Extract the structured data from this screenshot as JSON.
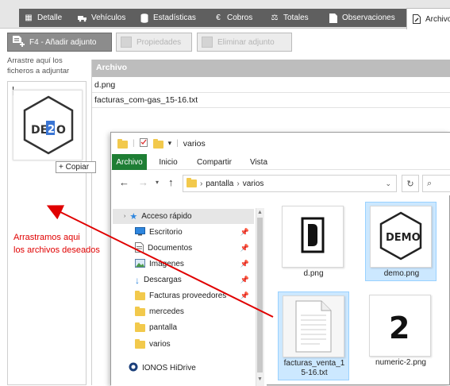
{
  "tabs": [
    {
      "label": "Detalle",
      "icon": "grid-icon"
    },
    {
      "label": "Vehículos",
      "icon": "truck-icon"
    },
    {
      "label": "Estadísticas",
      "icon": "database-icon"
    },
    {
      "label": "Cobros",
      "icon": "euro-icon"
    },
    {
      "label": "Totales",
      "icon": "scale-icon"
    },
    {
      "label": "Observaciones",
      "icon": "note-icon"
    },
    {
      "label": "Archivo",
      "icon": "file-edit-icon"
    }
  ],
  "toolbar": {
    "add_label": "F4 - Añadir adjunto",
    "properties_label": "Propiedades",
    "delete_label": "Eliminar adjunto"
  },
  "drop_hint": "Arrastre aquí los ficheros a adjuntar",
  "drag": {
    "copy_label": "+ Copiar",
    "thumb_text": "DEMO",
    "thumb_digit": "2"
  },
  "grid": {
    "header": "Archivo",
    "rows": [
      "d.png",
      "facturas_com-gas_15-16.txt"
    ]
  },
  "annotation": {
    "line1": "Arrastramos aqui",
    "line2": "los archivos deseados"
  },
  "explorer": {
    "title": "varios",
    "ribbon_tabs": [
      "Archivo",
      "Inicio",
      "Compartir",
      "Vista"
    ],
    "address": {
      "part1": "pantalla",
      "part2": "varios"
    },
    "nav_items": [
      {
        "label": "Acceso rápido",
        "icon": "star-icon",
        "selected": true
      },
      {
        "label": "Escritorio",
        "icon": "desktop-icon",
        "pinned": true
      },
      {
        "label": "Documentos",
        "icon": "documents-icon",
        "pinned": true
      },
      {
        "label": "Imágenes",
        "icon": "images-icon",
        "pinned": true
      },
      {
        "label": "Descargas",
        "icon": "download-icon",
        "pinned": true
      },
      {
        "label": "Facturas proveedores",
        "icon": "folder-icon",
        "pinned": true
      },
      {
        "label": "mercedes",
        "icon": "folder-icon"
      },
      {
        "label": "pantalla",
        "icon": "folder-icon"
      },
      {
        "label": "varios",
        "icon": "folder-icon"
      },
      {
        "label": "IONOS HiDrive",
        "icon": "cloud-drive-icon"
      }
    ],
    "files": [
      {
        "name": "d.png",
        "selected": false,
        "thumb_text": "D"
      },
      {
        "name": "demo.png",
        "selected": true,
        "thumb_text": "DEMO"
      },
      {
        "name": "facturas_venta_15-16.txt",
        "line1": "facturas_venta_1",
        "line2": "5-16.txt",
        "selected": true
      },
      {
        "name": "numeric-2.png",
        "selected": false,
        "thumb_text": "2"
      }
    ]
  },
  "colors": {
    "annotation": "#e00000",
    "selection": "#cce8ff",
    "ribbon_active": "#1e7e34",
    "tab_bg": "#5f5f5f"
  }
}
